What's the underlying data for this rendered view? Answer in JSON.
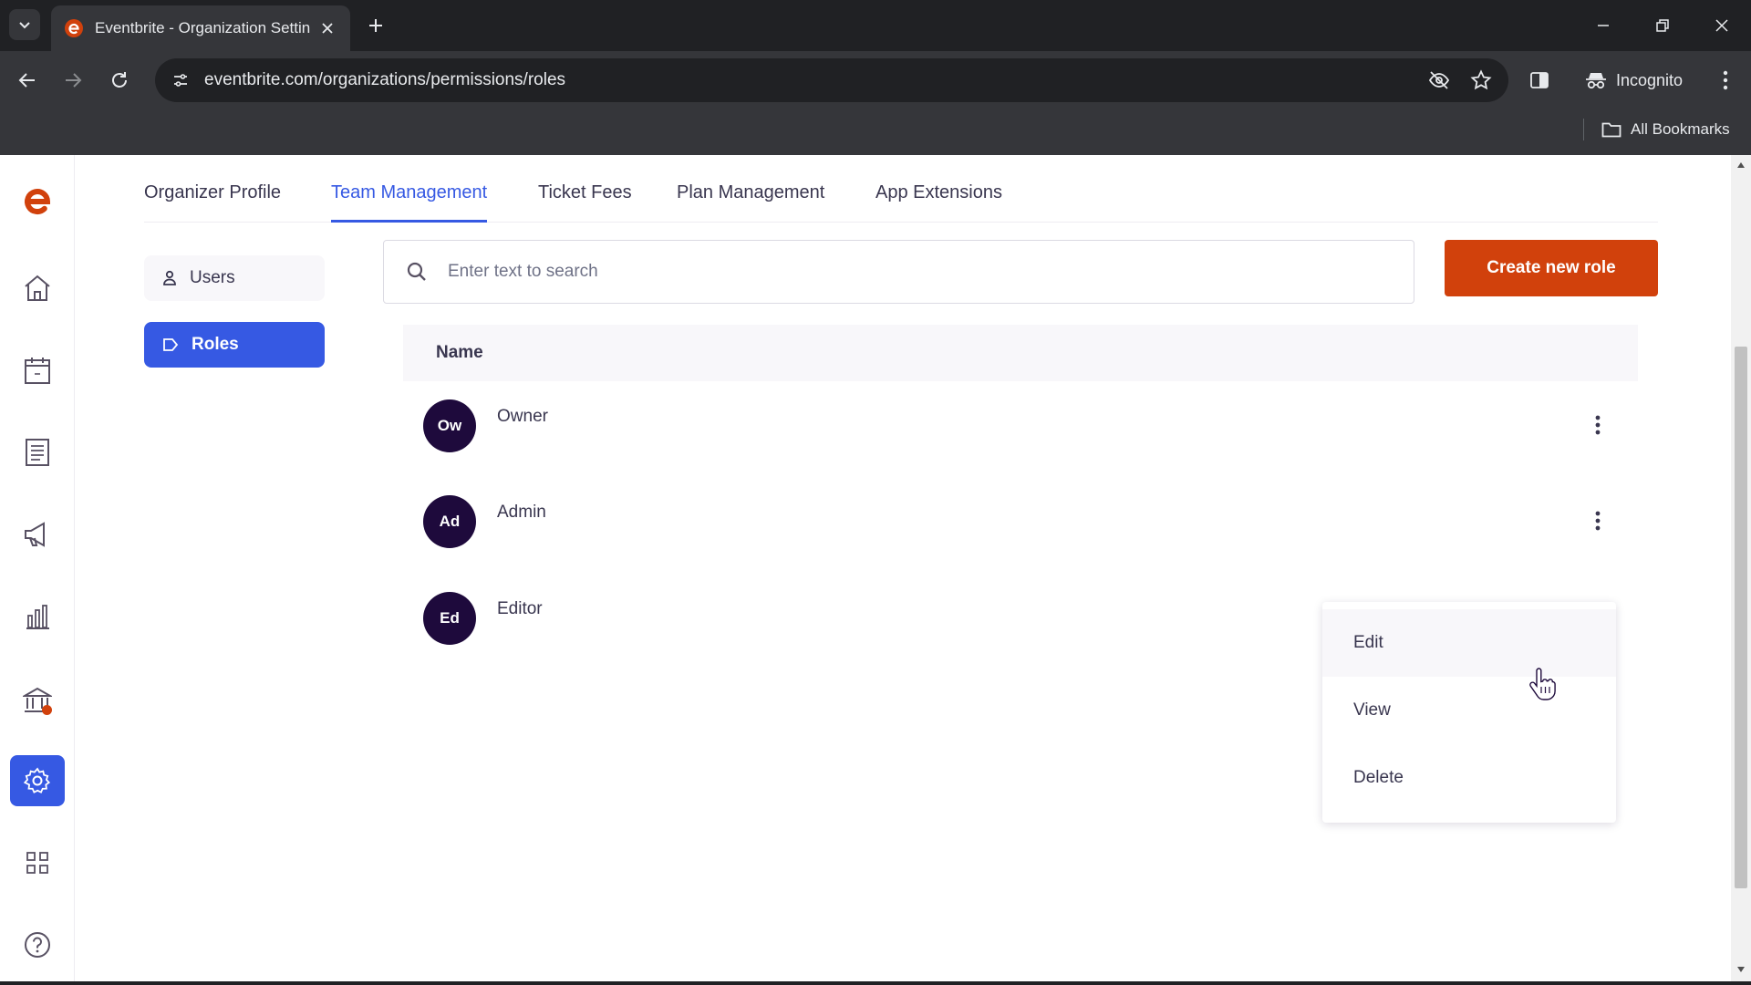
{
  "browser": {
    "tab_title": "Eventbrite - Organization Settin",
    "url": "eventbrite.com/organizations/permissions/roles",
    "incognito_label": "Incognito",
    "all_bookmarks_label": "All Bookmarks"
  },
  "colors": {
    "brand_orange": "#d1410c",
    "accent_blue": "#3659e3",
    "avatar_bg": "#1e0a3c"
  },
  "tabs": [
    {
      "label": "Organizer Profile",
      "active": false
    },
    {
      "label": "Team Management",
      "active": true
    },
    {
      "label": "Ticket Fees",
      "active": false
    },
    {
      "label": "Plan Management",
      "active": false
    },
    {
      "label": "App Extensions",
      "active": false
    }
  ],
  "subnav": {
    "users_label": "Users",
    "roles_label": "Roles",
    "selected": "Roles"
  },
  "search": {
    "placeholder": "Enter text to search"
  },
  "create_button_label": "Create new role",
  "table": {
    "header_name": "Name",
    "rows": [
      {
        "initials": "Ow",
        "name": "Owner"
      },
      {
        "initials": "Ad",
        "name": "Admin"
      },
      {
        "initials": "Ed",
        "name": "Editor"
      }
    ]
  },
  "dropdown": {
    "items": [
      "Edit",
      "View",
      "Delete"
    ],
    "hovered": "Edit"
  },
  "leftnav_icons": [
    "eventbrite-logo-icon",
    "home-icon",
    "calendar-icon",
    "orders-icon",
    "megaphone-icon",
    "reports-chart-icon",
    "finance-bank-icon",
    "settings-gear-icon",
    "apps-grid-icon",
    "help-icon"
  ]
}
